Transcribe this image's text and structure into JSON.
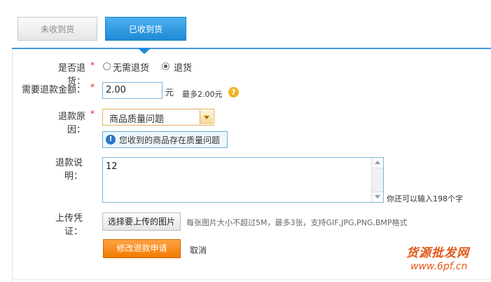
{
  "tabs": [
    {
      "label": "未收到货",
      "active": false
    },
    {
      "label": "已收到货",
      "active": true
    }
  ],
  "form": {
    "return_goods": {
      "label": "是否退货：",
      "required": "*",
      "options": [
        "无需退货",
        "退货"
      ],
      "selected": "退货"
    },
    "refund_amount": {
      "label": "需要退款金额：",
      "required": "*",
      "value": "2.00",
      "unit": "元",
      "hint": "最多2.00元",
      "help_icon": "?"
    },
    "refund_reason": {
      "label": "退款原因：",
      "required": "*",
      "selected": "商品质量问题",
      "notice": "您收到的商品存在质量问题",
      "notice_icon": "!"
    },
    "refund_note": {
      "label": "退款说明：",
      "value": "12",
      "counter": "你还可以输入198个字"
    },
    "upload": {
      "label": "上传凭证：",
      "button": "选择要上传的图片",
      "hint": "每张图片大小不超过5M，最多3张，支持GIF,JPG,PNG,BMP格式"
    },
    "submit": "修改退款申请",
    "cancel": "取消"
  },
  "watermark": {
    "line1": "货源批发网",
    "line2": "www.6pf.cn"
  },
  "colors": {
    "accent": "#1e8ad6",
    "orange": "#f27a00",
    "required": "#e0201f",
    "watermark": "#e25816"
  }
}
